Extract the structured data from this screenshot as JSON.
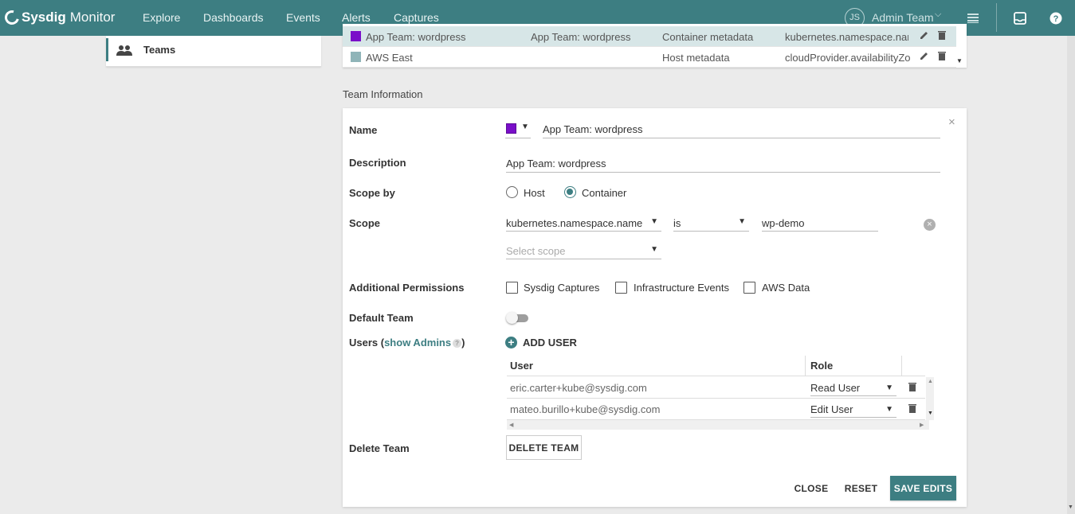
{
  "app": {
    "brand": "Sysdig",
    "product": "Monitor",
    "nav": [
      "Explore",
      "Dashboards",
      "Events",
      "Alerts",
      "Captures"
    ],
    "user_initials": "JS",
    "user_team": "Admin Team",
    "accent_color": "#3d7e82"
  },
  "sidebar": {
    "items": [
      {
        "label": "Teams",
        "icon": "people-icon"
      }
    ]
  },
  "teams_list": {
    "rows": [
      {
        "name": "App Team: wordpress",
        "description": "App Team: wordpress",
        "type": "Container metadata",
        "scope": "kubernetes.namespace.nam",
        "color": "#7a0fc9",
        "selected": true
      },
      {
        "name": "AWS East",
        "description": "",
        "type": "Host metadata",
        "scope": "cloudProvider.availabilityZor",
        "color": "#8fb4b8",
        "selected": false
      }
    ]
  },
  "team_info": {
    "title": "Team Information",
    "name_label": "Name",
    "name_value": "App Team: wordpress",
    "team_color": "#7a0fc9",
    "description_label": "Description",
    "description_value": "App Team: wordpress",
    "scope_by_label": "Scope by",
    "scope_by_options": [
      "Host",
      "Container"
    ],
    "scope_by_selected": "Container",
    "scope_label": "Scope",
    "scope": {
      "key": "kubernetes.namespace.name",
      "operator": "is",
      "value": "wp-demo",
      "add_placeholder": "Select scope"
    },
    "permissions_label": "Additional Permissions",
    "permissions": [
      {
        "label": "Sysdig Captures",
        "checked": false
      },
      {
        "label": "Infrastructure Events",
        "checked": false
      },
      {
        "label": "AWS Data",
        "checked": false
      }
    ],
    "default_team_label": "Default Team",
    "default_team_enabled": false,
    "users_label_prefix": "Users (",
    "users_label_link": "show Admins",
    "users_label_suffix": ")",
    "add_user_label": "ADD USER",
    "users_columns": [
      "User",
      "Role"
    ],
    "users": [
      {
        "email": "eric.carter+kube@sysdig.com",
        "role": "Read User"
      },
      {
        "email": "mateo.burillo+kube@sysdig.com",
        "role": "Edit User"
      }
    ],
    "delete_label": "Delete Team",
    "delete_button": "DELETE TEAM",
    "close_button": "CLOSE",
    "reset_button": "RESET",
    "save_button": "SAVE EDITS"
  }
}
